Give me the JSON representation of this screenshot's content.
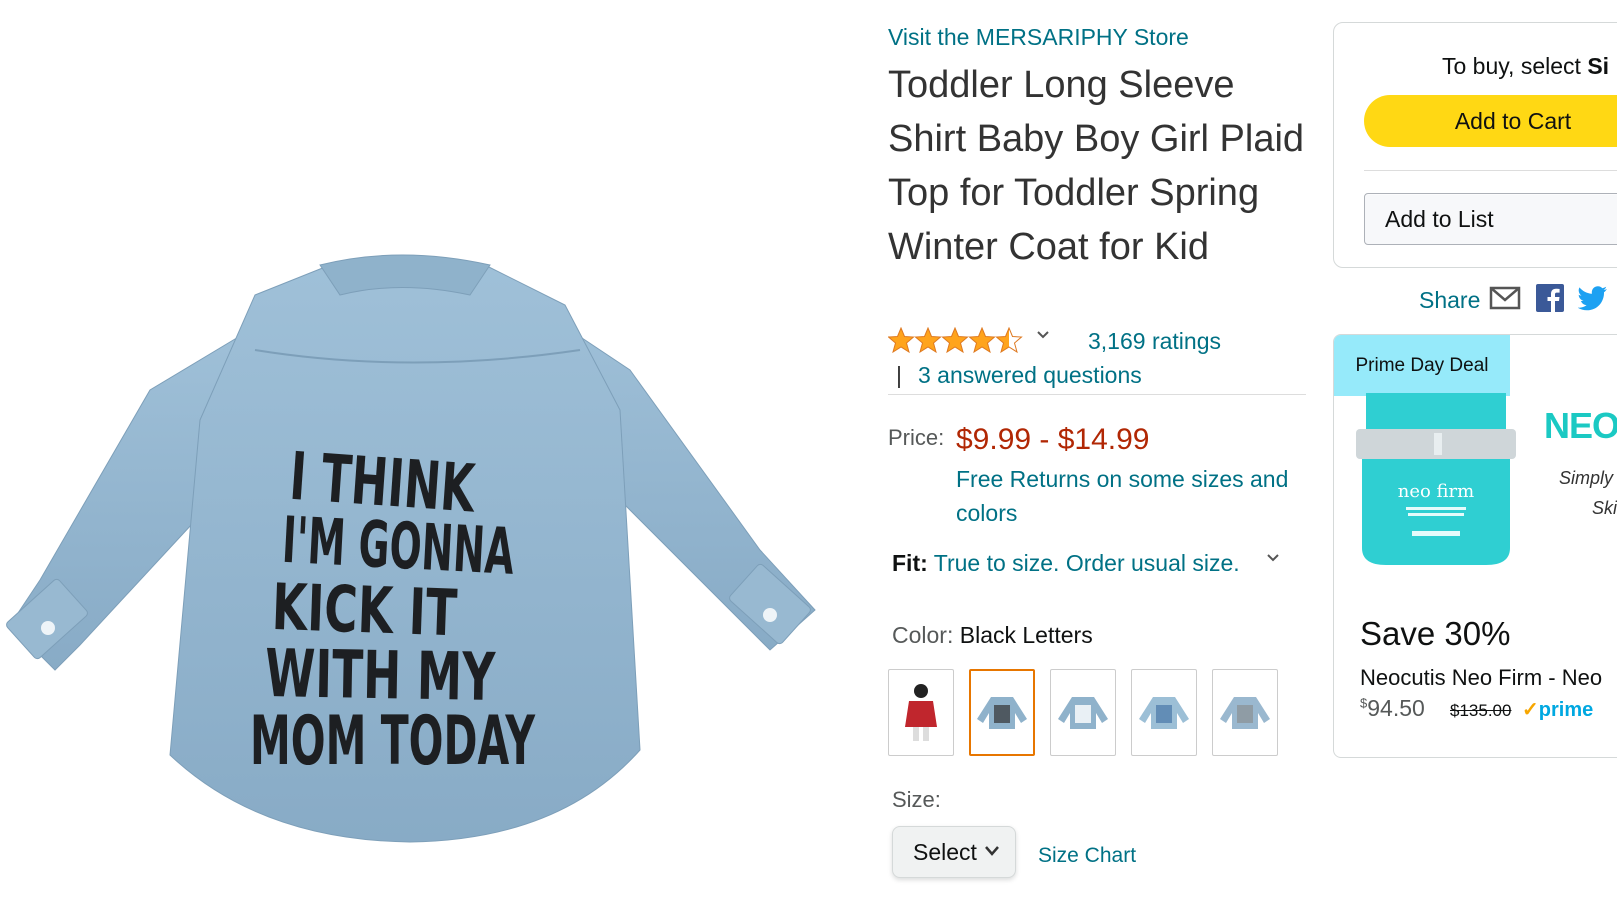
{
  "product": {
    "store_link": "Visit the MERSARIPHY Store",
    "title": "Toddler Long Sleeve Shirt Baby Boy Girl Plaid Top for Toddler Spring Winter Coat for Kid",
    "rating_stars": 4.5,
    "ratings_count": "3,169 ratings",
    "qa_separator": "|",
    "answered_questions": "3 answered questions",
    "price_label": "Price:",
    "price_range": "$9.99 - $14.99",
    "free_returns": "Free Returns on some sizes and colors",
    "fit_label": "Fit:",
    "fit_value": "True to size. Order usual size.",
    "color_label": "Color:",
    "color_value": "Black Letters",
    "color_options": [
      "Red",
      "Black Letters",
      "White Letters",
      "Blue Letters",
      "Gray Letters"
    ],
    "size_label": "Size:",
    "size_select": "Select",
    "size_chart": "Size Chart",
    "shirt_print_lines": [
      "I THINK",
      "I'M GONNA",
      "KICK IT",
      "WITH MY",
      "MOM TODAY"
    ]
  },
  "buybox": {
    "select_prefix": "To buy, select ",
    "select_strong": "Si",
    "add_to_cart": "Add to Cart",
    "add_to_list": "Add to List"
  },
  "share": {
    "label": "Share",
    "icons": [
      "mail-icon",
      "facebook-icon",
      "twitter-icon"
    ]
  },
  "deal": {
    "badge": "Prime Day Deal",
    "brand": "NEO",
    "jar_label": "neo firm",
    "tagline_1": "Simply",
    "tagline_2": "Ski",
    "save": "Save 30%",
    "name": "Neocutis Neo Firm - Neo",
    "price_symbol": "$",
    "price": "94.50",
    "old_price": "$135.00",
    "prime": "prime"
  },
  "colors": {
    "link": "#007185",
    "price": "#b12704",
    "cart_button": "#ffd814",
    "star": "#ffa41c",
    "deal_badge": "#96eafa",
    "selected_swatch": "#e77600"
  }
}
